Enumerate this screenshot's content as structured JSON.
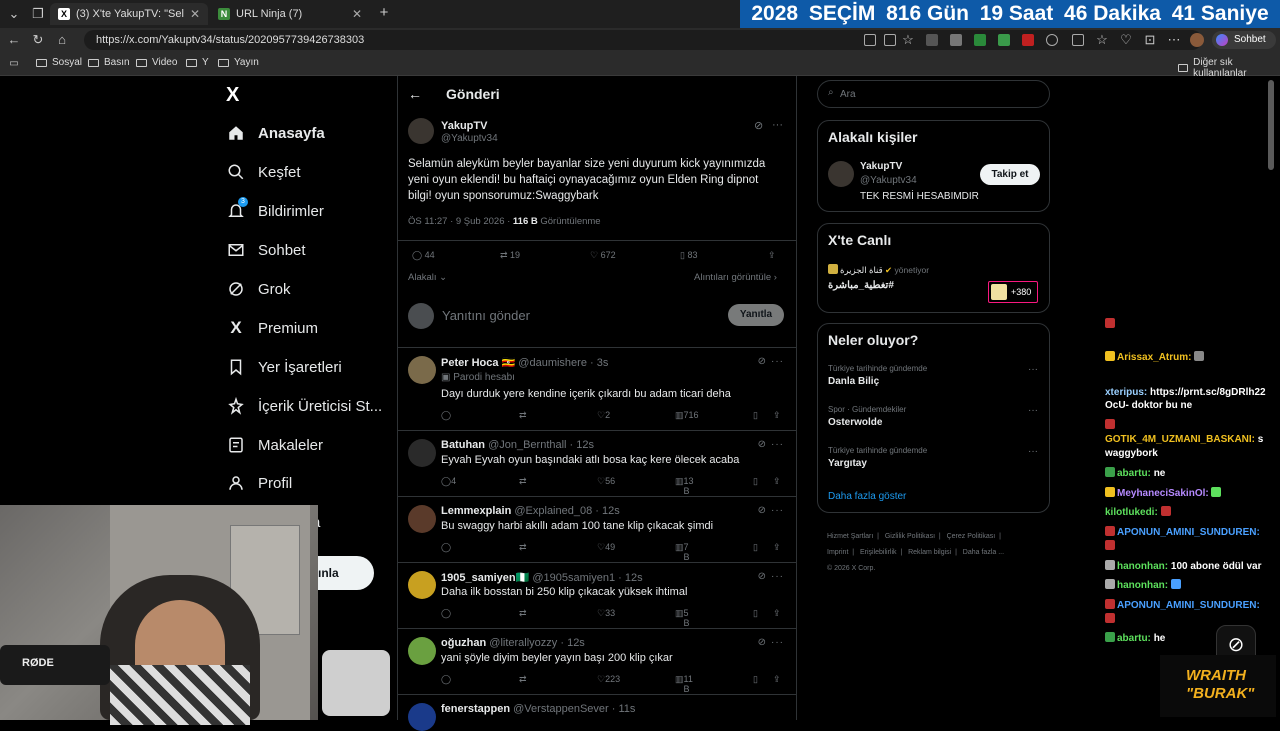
{
  "browser": {
    "tabs": [
      {
        "title": "(3) X'te YakupTV: \"Selamün aleykü...",
        "active": true,
        "favicon": "X"
      },
      {
        "title": "URL Ninja (7)",
        "active": false,
        "favicon": "N"
      }
    ],
    "url": "https://x.com/Yakuptv34/status/2020957739426738303",
    "sohbet_label": "Sohbet et",
    "bookmarks": [
      "Sosyal",
      "Basın",
      "Video",
      "Y",
      "Yayın"
    ],
    "other_bookmarks": "Diğer sık kullanılanlar"
  },
  "countdown": {
    "year": "2028",
    "label": "SEÇİM",
    "days": "816 Gün",
    "hours": "19 Saat",
    "minutes": "46 Dakika",
    "seconds": "41 Saniye",
    "bg_color": "#0e5aa8"
  },
  "sidebar": {
    "logo": "X",
    "items": [
      {
        "label": "Anasayfa",
        "icon": "home-icon"
      },
      {
        "label": "Keşfet",
        "icon": "search-icon"
      },
      {
        "label": "Bildirimler",
        "icon": "bell-icon",
        "badge": "3"
      },
      {
        "label": "Sohbet",
        "icon": "mail-icon"
      },
      {
        "label": "Grok",
        "icon": "grok-icon"
      },
      {
        "label": "Premium",
        "icon": "x-premium-icon"
      },
      {
        "label": "Yer İşaretleri",
        "icon": "bookmark-icon"
      },
      {
        "label": "İçerik Üreticisi St...",
        "icon": "creator-icon"
      },
      {
        "label": "Makaleler",
        "icon": "article-icon"
      },
      {
        "label": "Profil",
        "icon": "profile-icon"
      }
    ],
    "partial_item": "a",
    "post_button_partial": "ınla"
  },
  "post": {
    "header": "Gönderi",
    "author_name": "YakupTV",
    "author_handle": "@Yakuptv34",
    "text_lines": [
      "Selamün aleyküm beyler bayanlar size yeni duyurum kick yayınımızda",
      "yeni oyun eklendi! bu haftaiçi oynayacağımız oyun Elden Ring dipnot",
      "bilgi! oyun sponsorumuz:Swaggybark"
    ],
    "time": "ÖS 11:27 · 9 Şub 2026 · ",
    "views_value": "116 B",
    "views_label": " Görüntülenme",
    "replies": "44",
    "reposts": "19",
    "likes": "672",
    "bookmarks": "83",
    "relevant": "Alakalı",
    "quotes_link": "Alıntıları görüntüle",
    "reply_placeholder": "Yanıtını gönder",
    "reply_button": "Yanıtla"
  },
  "replies": [
    {
      "name": "Peter Hoca 🇺🇬",
      "handle": "@daumishere · 3s",
      "sub": "Parodi hesabı",
      "text": "Dayı durduk yere kendine içerik çıkardı bu adam ticari deha",
      "replies": "",
      "reposts": "",
      "likes": "2",
      "views": "716",
      "avatar": "#7a6a4a"
    },
    {
      "name": "Batuhan",
      "handle": "@Jon_Bernthall · 12s",
      "sub": "",
      "text": "Eyvah Eyvah oyun başındaki atlı bosa kaç kere ölecek acaba",
      "replies": "4",
      "reposts": "",
      "likes": "56",
      "views": "13 B",
      "avatar": "#2a2a2a"
    },
    {
      "name": "Lemmexplain",
      "handle": "@Explained_08 · 12s",
      "sub": "",
      "text": "Bu swaggy harbi akıllı adam 100 tane klip çıkacak şimdi",
      "replies": "",
      "reposts": "",
      "likes": "49",
      "views": "7 B",
      "avatar": "#5a3a2a"
    },
    {
      "name": "1905_samiyen🇳🇬",
      "handle": "@1905samiyen1 · 12s",
      "sub": "",
      "text": "Daha ilk bosstan bi 250 klip çıkacak yüksek ihtimal",
      "replies": "",
      "reposts": "",
      "likes": "33",
      "views": "5 B",
      "avatar": "#c8a020"
    },
    {
      "name": "oğuzhan",
      "handle": "@literallyozzy · 12s",
      "sub": "",
      "text": "yani şöyle diyim beyler yayın başı 200 klip çıkar",
      "replies": "",
      "reposts": "",
      "likes": "223",
      "views": "11 B",
      "avatar": "#6aa040"
    },
    {
      "name": "fenerstappen",
      "handle": "@VerstappenSever · 11s",
      "sub": "",
      "text": "",
      "replies": "",
      "reposts": "",
      "likes": "",
      "views": "",
      "avatar": "#1a3a8a"
    }
  ],
  "right": {
    "search_placeholder": "Ara",
    "related_title": "Alakalı kişiler",
    "related_name": "YakupTV",
    "related_handle": "@Yakuptv34",
    "related_bio": "TEK RESMİ HESABIMDIR",
    "follow_label": "Takip et",
    "live_title": "X'te Canlı",
    "live_host": "قناة الجزيرة",
    "live_managing": "yönetiyor",
    "live_topic": "تغطية_مباشرة#",
    "live_count": "+380",
    "whats_title": "Neler oluyor?",
    "trends": [
      {
        "meta": "Türkiye tarihinde gündemde",
        "name": "Danla Biliç"
      },
      {
        "meta": "Spor · Gündemdekiler",
        "name": "Osterwolde"
      },
      {
        "meta": "Türkiye tarihinde gündemde",
        "name": "Yargıtay"
      }
    ],
    "show_more": "Daha fazla göster",
    "footer_links": [
      "Hizmet Şartları",
      "Gizlilik Politikası",
      "Çerez Politikası",
      "Imprint",
      "Erişilebilirlik",
      "Reklam bilgisi",
      "Daha fazla ..."
    ],
    "copyright": "© 2026 X Corp."
  },
  "chat": [
    {
      "user": "Arissax_Atrum:",
      "msg": "",
      "color": "#f0c020"
    },
    {
      "user": "xteripus:",
      "msg": "https://prnt.sc/8gDRlh22",
      "color": "#9ad0ff"
    },
    {
      "user": "",
      "msg": "OcU- doktor bu ne",
      "color": "#fff"
    },
    {
      "user": "GOTIK_4M_UZMANI_BASKANI:",
      "msg": "s",
      "color": "#f0c020"
    },
    {
      "user": "",
      "msg": "waggybork",
      "color": "#fff"
    },
    {
      "user": "abartu:",
      "msg": "ne",
      "color": "#5de05d"
    },
    {
      "user": "MeyhaneciSakinOl:",
      "msg": "",
      "color": "#b68aff"
    },
    {
      "user": "kilotlukedi:",
      "msg": "",
      "color": "#5de05d"
    },
    {
      "user": "APONUN_AMINI_SUNDUREN:",
      "msg": "",
      "color": "#4aa0ff"
    },
    {
      "user": "hanonhan:",
      "msg": "100 abone ödül var",
      "color": "#5de05d"
    },
    {
      "user": "hanonhan:",
      "msg": "",
      "color": "#5de05d"
    },
    {
      "user": "APONUN_AMINI_SUNDUREN:",
      "msg": "",
      "color": "#4aa0ff"
    },
    {
      "user": "abartu:",
      "msg": "he",
      "color": "#5de05d"
    }
  ],
  "overlay": {
    "line1": "WRAITH",
    "line2": "\"BURAK\""
  },
  "webcam": {
    "mic_label": "RØDE"
  }
}
